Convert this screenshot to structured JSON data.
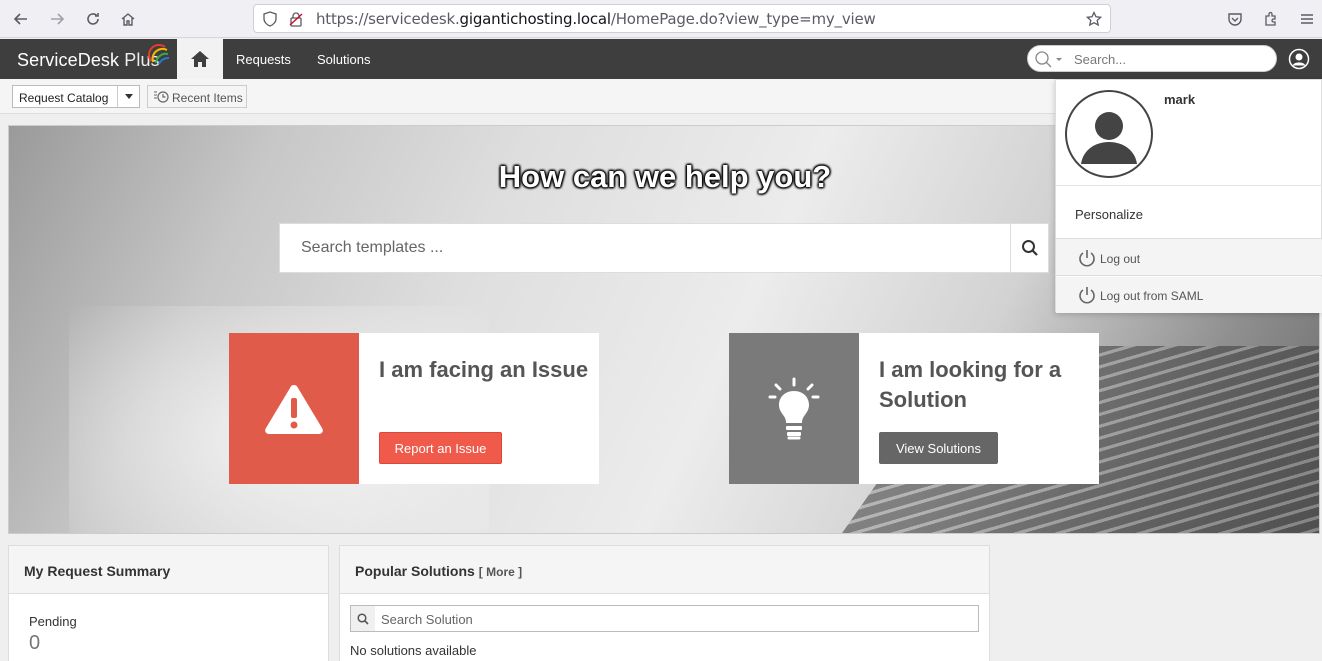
{
  "browser": {
    "url_prefix": "https://servicedesk.",
    "url_domain": "gigantichosting.local",
    "url_path": "/HomePage.do?view_type=my_view"
  },
  "header": {
    "logo_main": "ServiceDesk",
    "logo_plus": "Plus",
    "nav": [
      {
        "label": "Requests"
      },
      {
        "label": "Solutions"
      }
    ],
    "search_placeholder": "Search..."
  },
  "toolbar": {
    "catalog_label": "Request Catalog",
    "recent_label": "Recent Items"
  },
  "hero": {
    "title": "How can we help you?",
    "search_placeholder": "Search templates ...",
    "cards": [
      {
        "title": "I am facing an Issue",
        "action": "Report an Issue",
        "color": "#e15b4a",
        "button_color": "#f05a4b"
      },
      {
        "title": "I am looking for a Solution",
        "action": "View Solutions",
        "color": "#7a7a7a",
        "button_color": "#666666"
      }
    ]
  },
  "summary": {
    "title": "My Request Summary",
    "pending_label": "Pending",
    "pending_count": "0"
  },
  "solutions": {
    "title": "Popular Solutions",
    "more": "[ More ]",
    "search_placeholder": "Search Solution",
    "empty": "No solutions available"
  },
  "user_menu": {
    "username": "mark",
    "personalize": "Personalize",
    "logout": "Log out",
    "logout_saml": "Log out from SAML"
  }
}
